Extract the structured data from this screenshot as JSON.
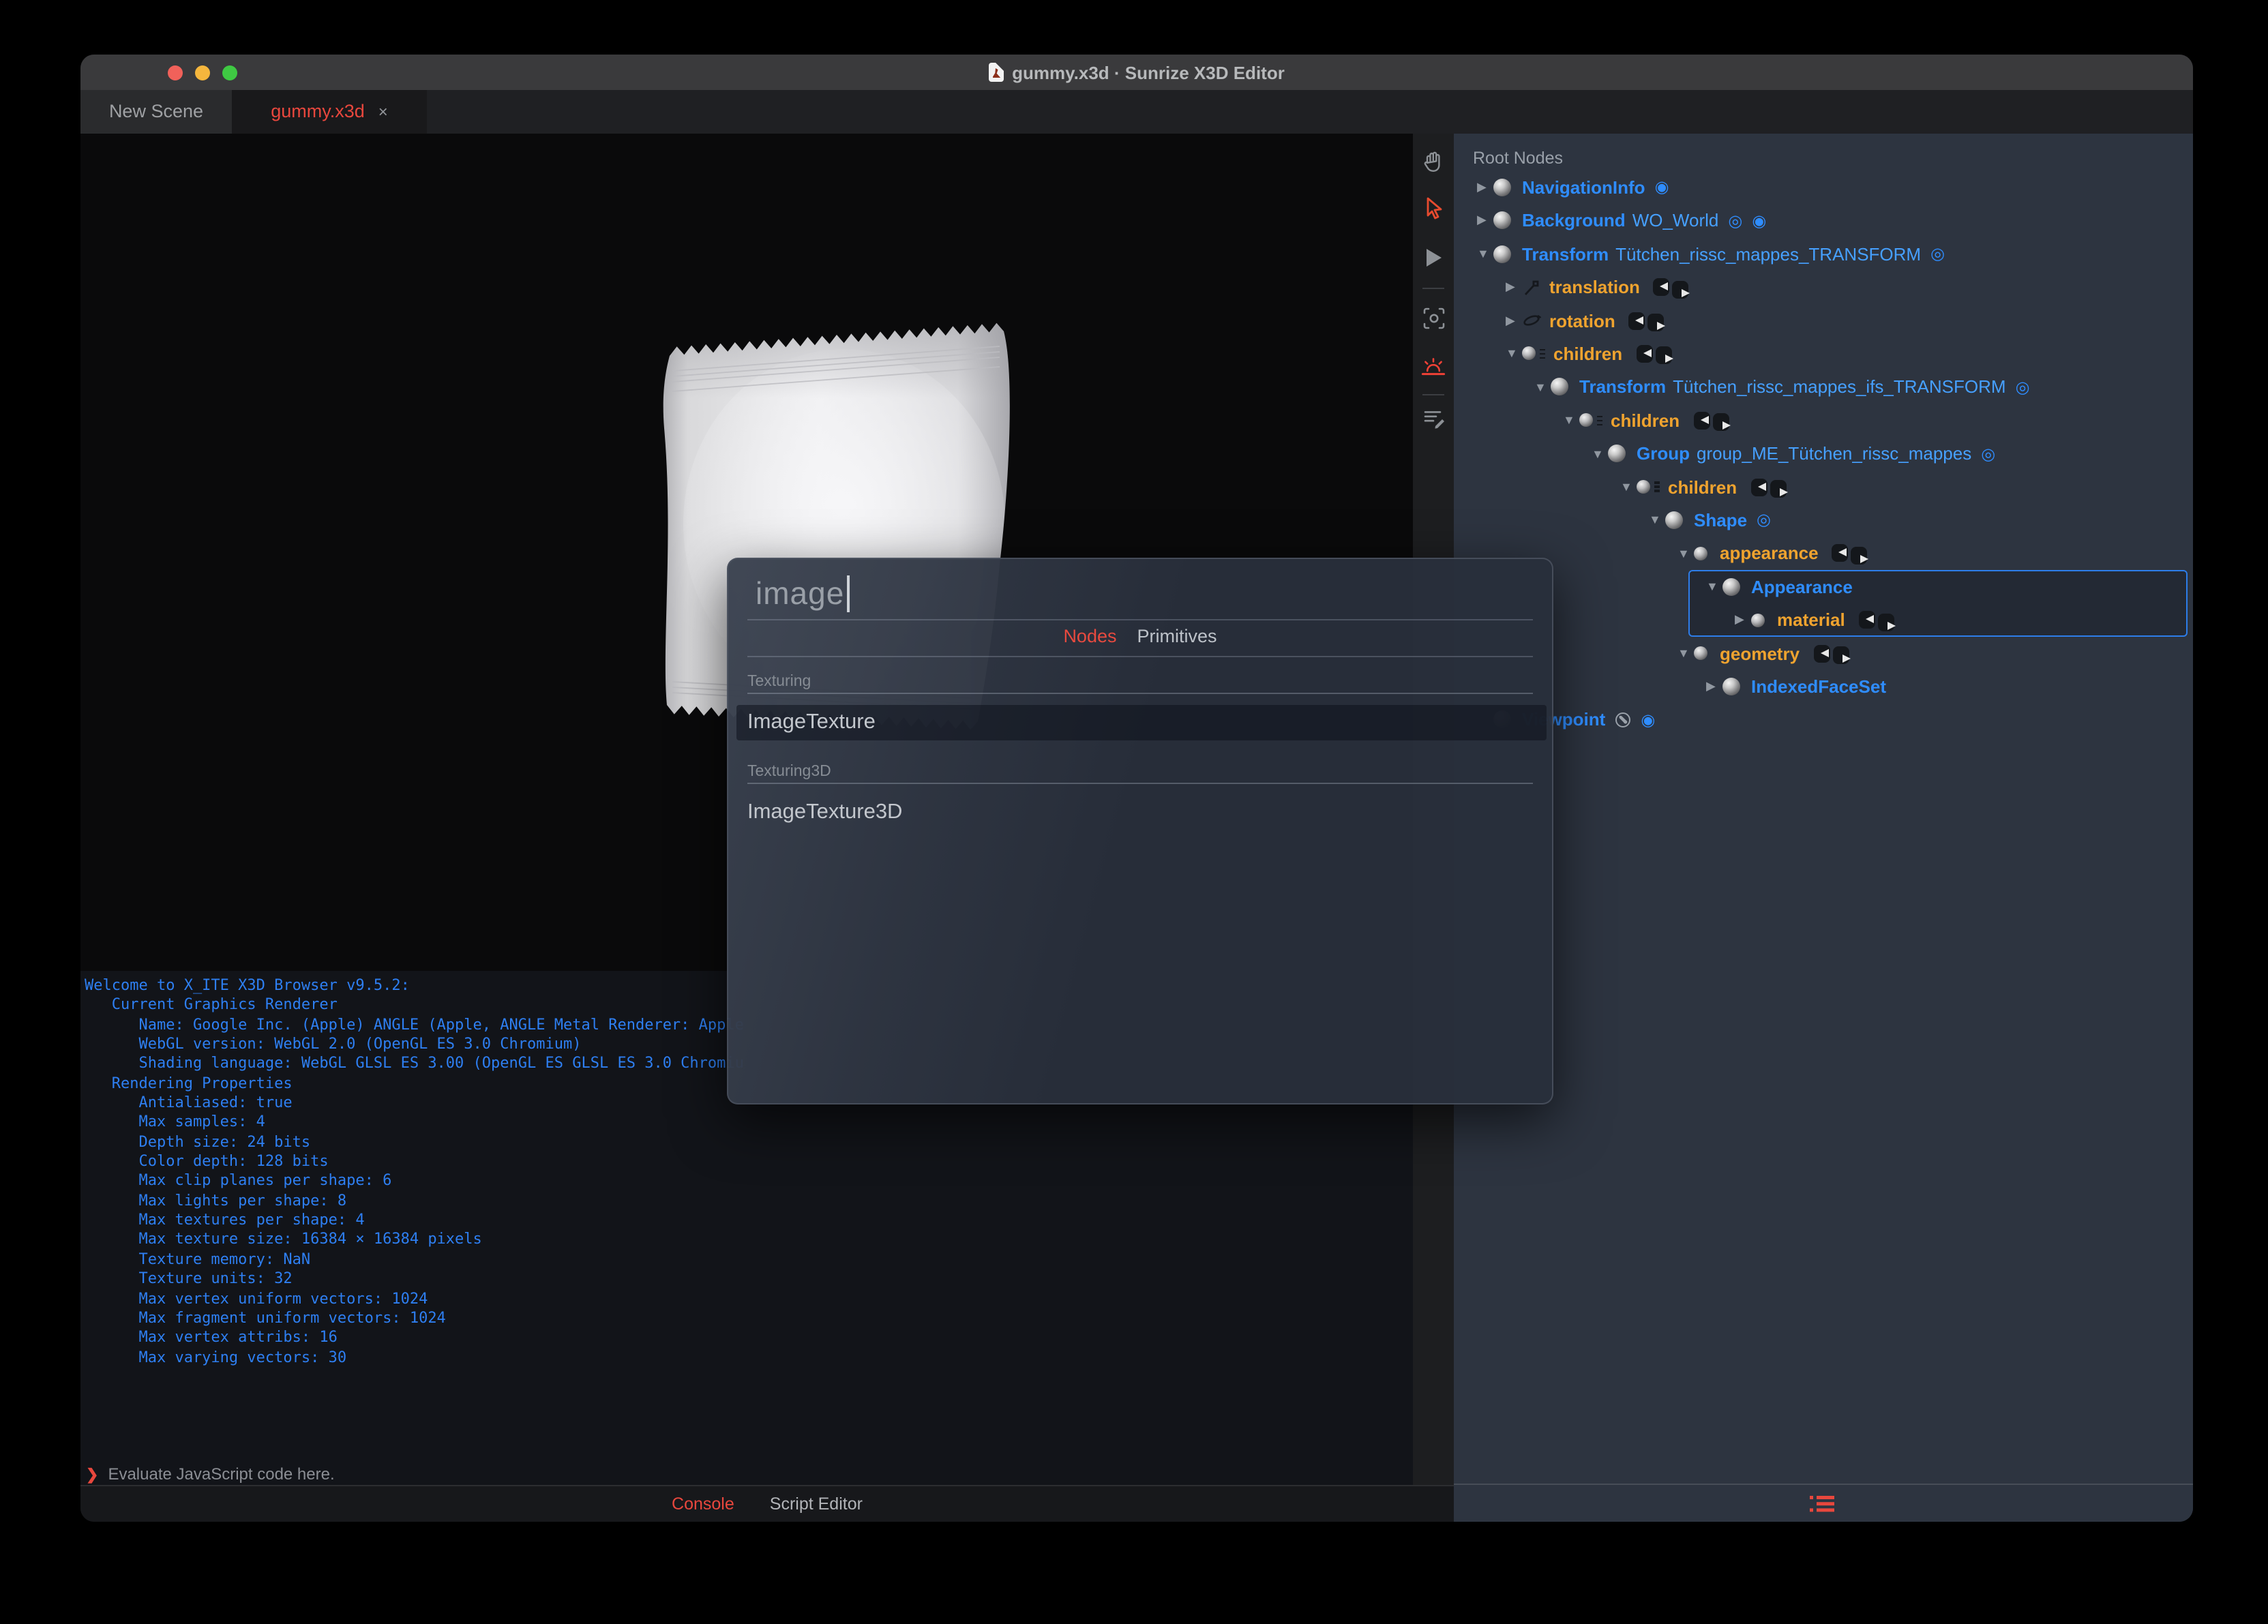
{
  "window": {
    "title": "gummy.x3d · Sunrize X3D Editor"
  },
  "tabs": [
    {
      "label": "New Scene",
      "active": false
    },
    {
      "label": "gummy.x3d",
      "active": true,
      "close": "×"
    }
  ],
  "toolbar": {
    "tools": [
      "pan-hand",
      "select-arrow",
      "play",
      "snapshot-camera",
      "sunrise-environment",
      "script-editor"
    ],
    "active_tools": [
      "select-arrow",
      "sunrise-environment"
    ]
  },
  "outline": {
    "header": "Root Nodes",
    "rows": [
      {
        "level": 0,
        "expander": "closed",
        "icon": "sphere",
        "name": "NavigationInfo",
        "def": "",
        "badges": [
          "bound"
        ]
      },
      {
        "level": 0,
        "expander": "closed",
        "icon": "sphere",
        "name": "Background",
        "def": "WO_World",
        "badges": [
          "eye",
          "bound"
        ]
      },
      {
        "level": 0,
        "expander": "open",
        "icon": "sphere",
        "name": "Transform",
        "def": "Tütchen_rissc_mappes_TRANSFORM",
        "badges": [
          "eye"
        ]
      },
      {
        "level": 1,
        "expander": "closed",
        "icon": "translation",
        "field": "translation",
        "routes": true
      },
      {
        "level": 1,
        "expander": "closed",
        "icon": "rotation",
        "field": "rotation",
        "routes": true
      },
      {
        "level": 1,
        "expander": "open",
        "icon": "mfnode",
        "field": "children",
        "routes": true
      },
      {
        "level": 2,
        "expander": "open",
        "icon": "sphere",
        "name": "Transform",
        "def": "Tütchen_rissc_mappes_ifs_TRANSFORM",
        "badges": [
          "eye"
        ]
      },
      {
        "level": 3,
        "expander": "open",
        "icon": "mfnode",
        "field": "children",
        "routes": true
      },
      {
        "level": 4,
        "expander": "open",
        "icon": "sphere",
        "name": "Group",
        "def": "group_ME_Tütchen_rissc_mappes",
        "badges": [
          "eye"
        ]
      },
      {
        "level": 5,
        "expander": "open",
        "icon": "mfnode",
        "field": "children",
        "routes": true
      },
      {
        "level": 6,
        "expander": "open",
        "icon": "sphere",
        "name": "Shape",
        "def": "",
        "badges": [
          "eye"
        ]
      },
      {
        "level": 7,
        "expander": "open",
        "icon": "sfnode",
        "field": "appearance",
        "routes": true
      },
      {
        "level": 8,
        "expander": "open",
        "icon": "sphere",
        "name": "Appearance",
        "def": "",
        "badges": []
      },
      {
        "level": 9,
        "expander": "closed",
        "icon": "sfnode",
        "field": "material",
        "routes": true
      },
      {
        "level": 7,
        "expander": "open",
        "icon": "sfnode",
        "field": "geometry",
        "routes": true
      },
      {
        "level": 8,
        "expander": "closed",
        "icon": "sphere",
        "name": "IndexedFaceSet",
        "def": "",
        "badges": []
      },
      {
        "level": 0,
        "expander": "none",
        "icon": "sphere",
        "name": "Viewpoint",
        "def": "",
        "badges": [
          "wrench",
          "bound"
        ]
      }
    ],
    "selected_rows": [
      12,
      13
    ]
  },
  "console": {
    "lines": [
      "Welcome to X_ITE X3D Browser v9.5.2:",
      "   Current Graphics Renderer",
      "      Name: Google Inc. (Apple) ANGLE (Apple, ANGLE Metal Renderer: Apple",
      "      WebGL version: WebGL 2.0 (OpenGL ES 3.0 Chromium)",
      "      Shading language: WebGL GLSL ES 3.00 (OpenGL ES GLSL ES 3.0 Chromiu",
      "   Rendering Properties",
      "      Antialiased: true",
      "      Max samples: 4",
      "      Depth size: 24 bits",
      "      Color depth: 128 bits",
      "      Max clip planes per shape: 6",
      "      Max lights per shape: 8",
      "      Max textures per shape: 4",
      "      Max texture size: 16384 × 16384 pixels",
      "      Texture memory: NaN",
      "      Texture units: 32",
      "      Max vertex uniform vectors: 1024",
      "      Max fragment uniform vectors: 1024",
      "      Max vertex attribs: 16",
      "      Max varying vectors: 30"
    ],
    "prompt_chevron": "❯",
    "prompt_placeholder": "Evaluate JavaScript code here."
  },
  "bottom_tabs": {
    "console": "Console",
    "script_editor": "Script Editor"
  },
  "dialog": {
    "search_value": "image",
    "tabs": {
      "nodes": "Nodes",
      "primitives": "Primitives"
    },
    "active_tab": "Nodes",
    "sections": [
      {
        "label": "Texturing",
        "items": [
          {
            "label": "ImageTexture",
            "selected": true
          }
        ]
      },
      {
        "label": "Texturing3D",
        "items": [
          {
            "label": "ImageTexture3D",
            "selected": false
          }
        ]
      }
    ]
  },
  "colors": {
    "accent_red": "#e8473d",
    "node_blue": "#2f8dff",
    "field_orange": "#efa32f",
    "console_blue": "#2e7ff2",
    "panel_slate": "#2d3440"
  }
}
